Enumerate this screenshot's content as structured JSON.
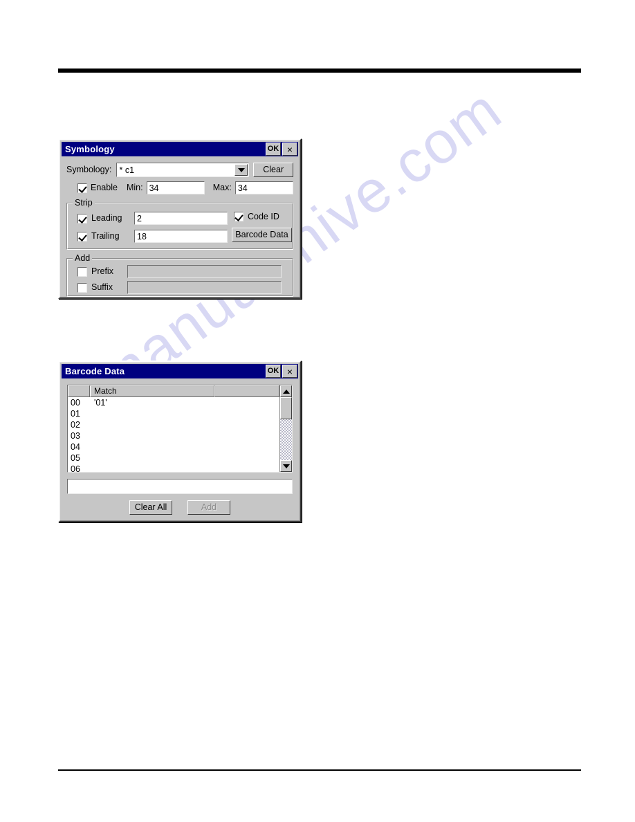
{
  "page": {
    "watermark": "manualshive.com",
    "background_color": "#ffffff",
    "rule_color": "#000000"
  },
  "symbology_dialog": {
    "title": "Symbology",
    "ok_label": "OK",
    "close_label": "×",
    "symbology_label": "Symbology:",
    "symbology_value": "* c1",
    "clear_label": "Clear",
    "enable_label": "Enable",
    "enable_checked": true,
    "min_label": "Min:",
    "min_value": "34",
    "max_label": "Max:",
    "max_value": "34",
    "strip": {
      "title": "Strip",
      "leading_label": "Leading",
      "leading_checked": true,
      "leading_value": "2",
      "trailing_label": "Trailing",
      "trailing_checked": true,
      "trailing_value": "18",
      "code_id_label": "Code ID",
      "code_id_checked": true,
      "barcode_data_label": "Barcode Data"
    },
    "add": {
      "title": "Add",
      "prefix_label": "Prefix",
      "prefix_checked": false,
      "prefix_value": "",
      "suffix_label": "Suffix",
      "suffix_checked": false,
      "suffix_value": ""
    }
  },
  "barcode_dialog": {
    "title": "Barcode Data",
    "ok_label": "OK",
    "close_label": "×",
    "columns": [
      "",
      "Match",
      ""
    ],
    "rows": [
      {
        "index": "00",
        "match": "'01'"
      },
      {
        "index": "01",
        "match": ""
      },
      {
        "index": "02",
        "match": ""
      },
      {
        "index": "03",
        "match": ""
      },
      {
        "index": "04",
        "match": ""
      },
      {
        "index": "05",
        "match": ""
      },
      {
        "index": "06",
        "match": ""
      }
    ],
    "entry_value": "",
    "clear_all_label": "Clear All",
    "add_label": "Add",
    "add_enabled": false,
    "scroll_up_icon": "triangle-up-icon",
    "scroll_down_icon": "triangle-down-icon"
  }
}
